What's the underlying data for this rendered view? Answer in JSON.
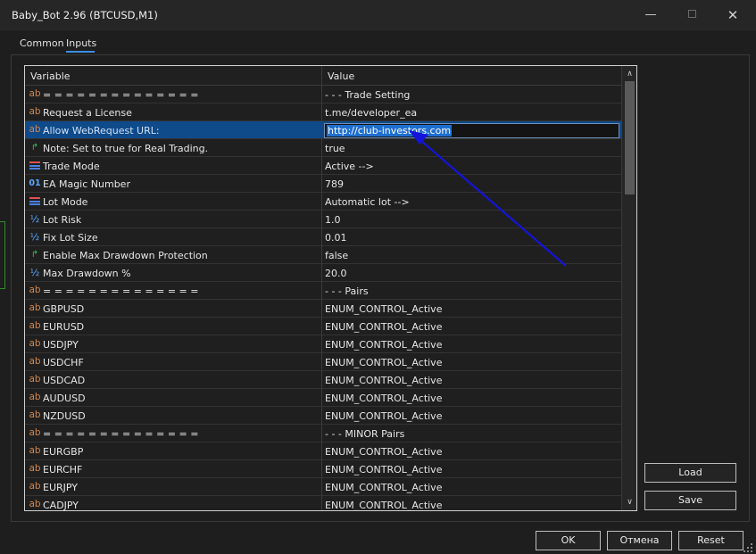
{
  "window": {
    "title": "Baby_Bot 2.96 (BTCUSD,M1)",
    "minimize_glyph": "—",
    "close_glyph": "✕"
  },
  "tabs": [
    {
      "label": "Common"
    },
    {
      "label": "Inputs"
    }
  ],
  "grid": {
    "headers": {
      "variable": "Variable",
      "value": "Value"
    },
    "rows": [
      {
        "icon": "ab",
        "name": "= = = = = = = = = = = = = =",
        "value": "- - - Trade Setting"
      },
      {
        "icon": "ab",
        "name": "Request a License",
        "value": "t.me/developer_ea"
      },
      {
        "icon": "ab",
        "name": "Allow WebRequest URL:",
        "value": "http://club-investors.com"
      },
      {
        "icon": "bool",
        "name": "Note: Set to true for Real Trading.",
        "value": "true"
      },
      {
        "icon": "enum",
        "name": "Trade Mode",
        "value": "Active -->"
      },
      {
        "icon": "int",
        "name": "EA Magic Number",
        "value": "789"
      },
      {
        "icon": "enum",
        "name": "Lot Mode",
        "value": "Automatic lot -->"
      },
      {
        "icon": "dbl",
        "name": "Lot Risk",
        "value": "1.0"
      },
      {
        "icon": "dbl",
        "name": "Fix Lot Size",
        "value": "0.01"
      },
      {
        "icon": "bool",
        "name": "Enable Max Drawdown Protection",
        "value": "false"
      },
      {
        "icon": "dbl",
        "name": "Max Drawdown %",
        "value": "20.0"
      },
      {
        "icon": "ab",
        "name": "= = = = = = = = = = = = = =",
        "value": "- - - Pairs"
      },
      {
        "icon": "ab",
        "name": "GBPUSD",
        "value": "ENUM_CONTROL_Active"
      },
      {
        "icon": "ab",
        "name": "EURUSD",
        "value": "ENUM_CONTROL_Active"
      },
      {
        "icon": "ab",
        "name": "USDJPY",
        "value": "ENUM_CONTROL_Active"
      },
      {
        "icon": "ab",
        "name": "USDCHF",
        "value": "ENUM_CONTROL_Active"
      },
      {
        "icon": "ab",
        "name": "USDCAD",
        "value": "ENUM_CONTROL_Active"
      },
      {
        "icon": "ab",
        "name": "AUDUSD",
        "value": "ENUM_CONTROL_Active"
      },
      {
        "icon": "ab",
        "name": "NZDUSD",
        "value": "ENUM_CONTROL_Active"
      },
      {
        "icon": "ab",
        "name": "= = = = = = = = = = = = = =",
        "value": "- - - MINOR Pairs"
      },
      {
        "icon": "ab",
        "name": "EURGBP",
        "value": "ENUM_CONTROL_Active"
      },
      {
        "icon": "ab",
        "name": "EURCHF",
        "value": "ENUM_CONTROL_Active"
      },
      {
        "icon": "ab",
        "name": "EURJPY",
        "value": "ENUM_CONTROL_Active"
      },
      {
        "icon": "ab",
        "name": "CADJPY",
        "value": "ENUM_CONTROL_Active"
      }
    ],
    "selected_row": 2,
    "scroll": {
      "up_glyph": "∧",
      "down_glyph": "∨"
    }
  },
  "icons": {
    "ab": "ab",
    "bool": "↱",
    "int": "01",
    "dbl": "½",
    "enum_colors": [
      "#e05050",
      "#4a7fe0",
      "#4a7fe0"
    ]
  },
  "buttons": {
    "load": "Load",
    "save": "Save",
    "ok": "OK",
    "cancel": "Отмена",
    "reset": "Reset"
  },
  "annotation": {
    "arrow_color": "#1414d8"
  }
}
